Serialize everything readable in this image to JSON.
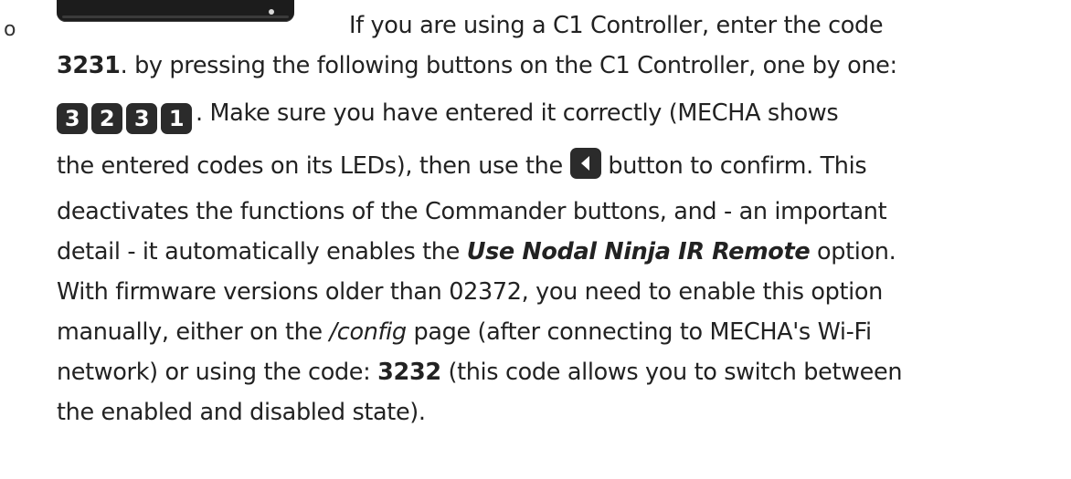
{
  "bullet": "o",
  "line1": "If you are using a C1 Controller, enter the code",
  "line2": {
    "code": "3231",
    "rest": ". by pressing the following buttons on the C1 Controller, one by one:"
  },
  "keys": [
    "3",
    "2",
    "3",
    "1"
  ],
  "line3_rest": ". Make sure you have entered it correctly (MECHA shows",
  "line4": {
    "before": "the entered codes on its LEDs), then use the",
    "after": "button to confirm. This"
  },
  "line5": "deactivates the functions of the Commander buttons, and - an important",
  "line6": {
    "before": "detail - it automatically enables the",
    "emphasis": "Use Nodal Ninja IR Remote",
    "after": "option."
  },
  "line7": "With firmware versions older than 02372, you need to enable this option",
  "line8": {
    "before": "manually, either on the",
    "path": "/config",
    "after": "page (after connecting to MECHA's Wi-Fi"
  },
  "line9": {
    "before": "network) or using the code:",
    "code": "3232",
    "after": "(this code allows you to switch between"
  },
  "line10": "the enabled and disabled state).",
  "icons": {
    "device": "c1-controller-image",
    "confirm": "left-arrow-button-icon"
  }
}
